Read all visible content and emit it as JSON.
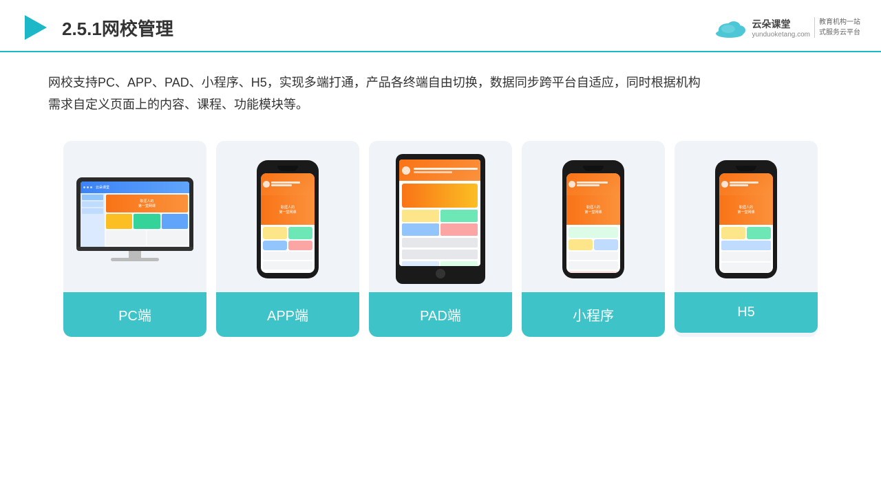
{
  "header": {
    "title": "2.5.1网校管理",
    "logo_name": "云朵课堂",
    "logo_url": "yunduoketang.com",
    "logo_sub": "教育机构一站\n式服务云平台"
  },
  "description": {
    "text": "网校支持PC、APP、PAD、小程序、H5，实现多端打通，产品各终端自由切换，数据同步跨平台自适应，同时根据机构\n需求自定义页面上的内容、课程、功能模块等。"
  },
  "cards": [
    {
      "label": "PC端",
      "type": "pc"
    },
    {
      "label": "APP端",
      "type": "phone"
    },
    {
      "label": "PAD端",
      "type": "pad"
    },
    {
      "label": "小程序",
      "type": "phone"
    },
    {
      "label": "H5",
      "type": "phone"
    }
  ],
  "colors": {
    "teal": "#3ec4c8",
    "accent": "#1db8c8",
    "header_line": "#1db8c8"
  }
}
